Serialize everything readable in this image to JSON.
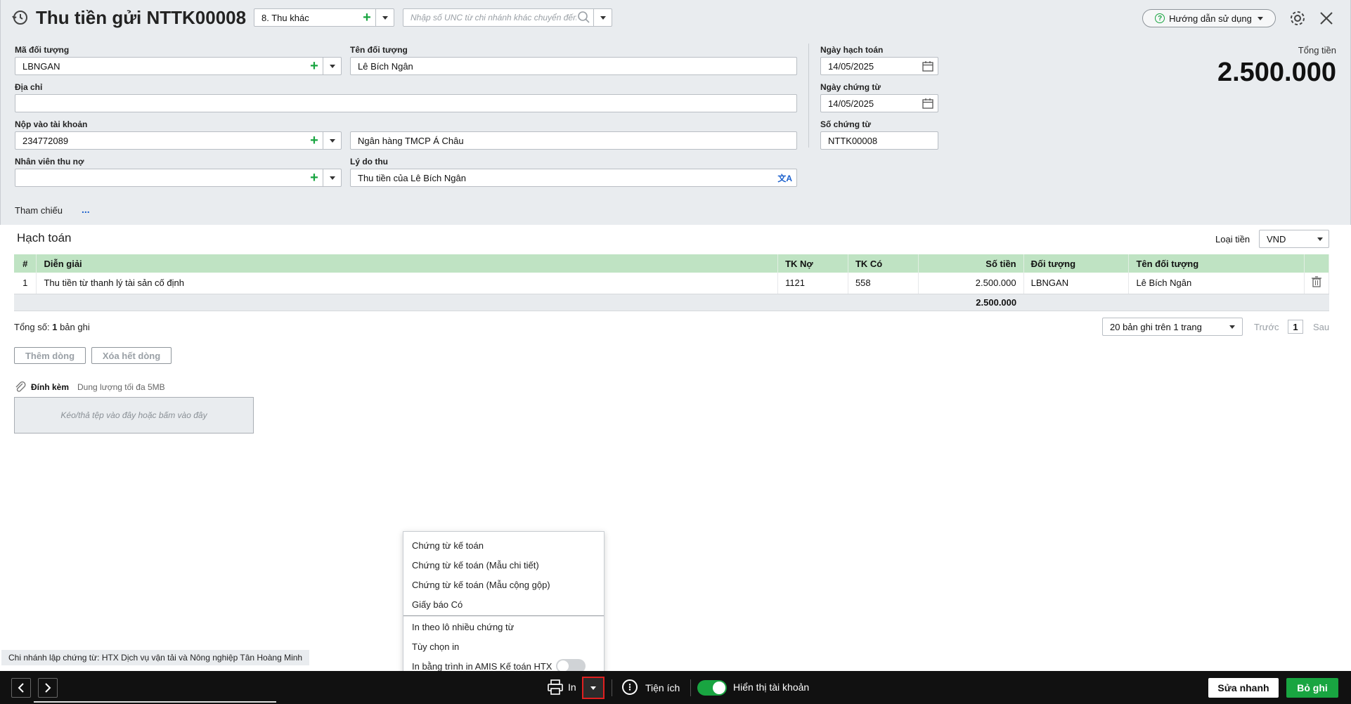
{
  "header": {
    "title": "Thu tiền gửi NTTK00008",
    "type_select": "8. Thu khác",
    "unc_placeholder": "Nhập số UNC từ chi nhánh khác chuyển đến",
    "help_label": "Hướng dẫn sử dụng"
  },
  "form": {
    "object_code_label": "Mã đối tượng",
    "object_code": "LBNGAN",
    "object_name_label": "Tên đối tượng",
    "object_name": "Lê Bích Ngân",
    "address_label": "Địa chỉ",
    "address": "",
    "account_label": "Nộp vào tài khoản",
    "account": "234772089",
    "bank_name": "Ngân hàng TMCP Á Châu",
    "employee_label": "Nhân viên thu nợ",
    "employee": "",
    "reason_label": "Lý do thu",
    "reason": "Thu tiền của Lê Bích Ngân",
    "posting_date_label": "Ngày hạch toán",
    "posting_date": "14/05/2025",
    "doc_date_label": "Ngày chứng từ",
    "doc_date": "14/05/2025",
    "doc_no_label": "Số chứng từ",
    "doc_no": "NTTK00008",
    "total_label": "Tổng tiền",
    "total_value": "2.500.000",
    "reference_label": "Tham chiếu",
    "reference_dots": "..."
  },
  "accounting": {
    "title": "Hạch toán",
    "currency_label": "Loại tiền",
    "currency": "VND",
    "columns": [
      "#",
      "Diễn giải",
      "TK Nợ",
      "TK Có",
      "Số tiền",
      "Đối tượng",
      "Tên đối tượng"
    ],
    "rows": [
      {
        "no": "1",
        "desc": "Thu tiền từ thanh lý tài sản cố định",
        "debit": "1121",
        "credit": "558",
        "amount": "2.500.000",
        "object": "LBNGAN",
        "object_name": "Lê Bích Ngân"
      }
    ],
    "sum_amount": "2.500.000",
    "record_prefix": "Tổng số:",
    "record_count": "1",
    "record_suffix": "bản ghi",
    "page_size": "20 bản ghi trên 1 trang",
    "prev": "Trước",
    "page": "1",
    "next": "Sau",
    "add_row": "Thêm dòng",
    "clear_rows": "Xóa hết dòng"
  },
  "attach": {
    "label": "Đính kèm",
    "hint": "Dung lượng tối đa 5MB",
    "dropzone": "Kéo/thả tệp vào đây hoặc bấm vào đây"
  },
  "branch": "Chi nhánh lập chứng từ: HTX Dịch vụ vận tải và Nông nghiệp Tân Hoàng Minh",
  "print_menu": {
    "items_top": [
      "Chứng từ kế toán",
      "Chứng từ kế toán (Mẫu chi tiết)",
      "Chứng từ kế toán (Mẫu cộng gộp)",
      "Giấy báo Có"
    ],
    "items_bottom": [
      "In theo lô nhiều chứng từ",
      "Tùy chọn in"
    ],
    "amis_print": "In bằng trình in AMIS Kế toán HTX"
  },
  "footer": {
    "print_label": "In",
    "utility_label": "Tiện ích",
    "show_account_label": "Hiển thị tài khoản",
    "quick_edit": "Sửa nhanh",
    "skip_save": "Bỏ ghi"
  },
  "colors": {
    "accent_green": "#19a541",
    "table_header": "#bfe3c3",
    "highlight_red": "#e02020"
  }
}
